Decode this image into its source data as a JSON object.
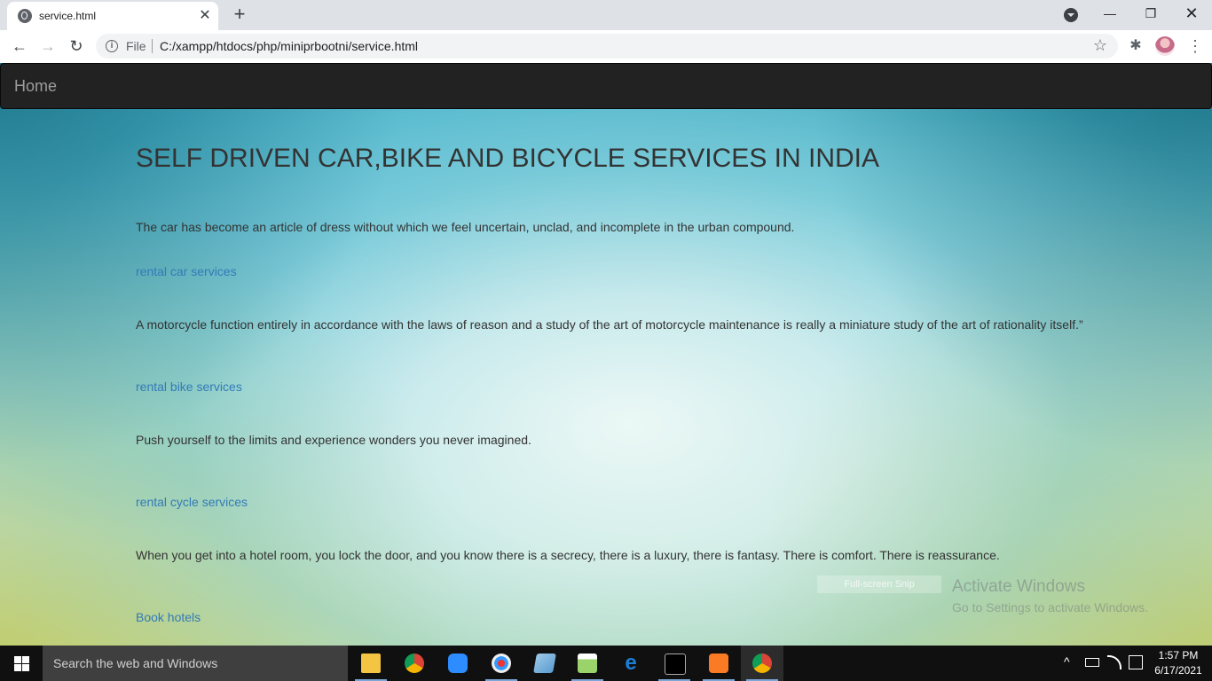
{
  "browser": {
    "tab_title": "service.html",
    "tab_close": "✕",
    "new_tab": "+",
    "scheme_label": "File",
    "url": "C:/xampp/htdocs/php/miniprbootni/service.html",
    "window_controls": {
      "minimize": "—",
      "maximize": "❐",
      "close": "✕"
    },
    "nav": {
      "back": "←",
      "forward": "→",
      "reload": "↻"
    },
    "info_icon": "i",
    "bookmark_icon": "☆",
    "extensions_icon": "✱",
    "menu_icon": "⋮"
  },
  "page": {
    "navbar": {
      "home_label": "Home"
    },
    "heading": "SELF DRIVEN CAR,BIKE AND BICYCLE SERVICES IN INDIA",
    "sections": [
      {
        "text": "The car has become an article of dress without which we feel uncertain, unclad, and incomplete in the urban compound.",
        "link": "rental car services"
      },
      {
        "text": "A motorcycle function entirely in accordance with the laws of reason and a study of the art of motorcycle maintenance is really a miniature study of the art of rationality itself.”",
        "link": "rental bike services"
      },
      {
        "text": "Push yourself to the limits and experience wonders you never imagined.",
        "link": "rental cycle services"
      },
      {
        "text": "When you get into a hotel room, you lock the door, and you know there is a secrecy, there is a luxury, there is fantasy. There is comfort. There is reassurance.",
        "link": "Book hotels"
      }
    ]
  },
  "overlay": {
    "snip_label": "Full-screen Snip",
    "activate_title": "Activate Windows",
    "activate_sub": "Go to Settings to activate Windows."
  },
  "taskbar": {
    "search_placeholder": "Search the web and Windows",
    "apps": [
      "file-explorer",
      "chrome",
      "zoom",
      "paint",
      "notepad",
      "notepad-plus",
      "edge",
      "cmd",
      "xampp",
      "chrome-profile"
    ],
    "tray_up": "^",
    "time": "1:57 PM",
    "date": "6/17/2021"
  },
  "colors": {
    "navbar_bg": "#222222",
    "link": "#337ab7",
    "text": "#333333"
  }
}
